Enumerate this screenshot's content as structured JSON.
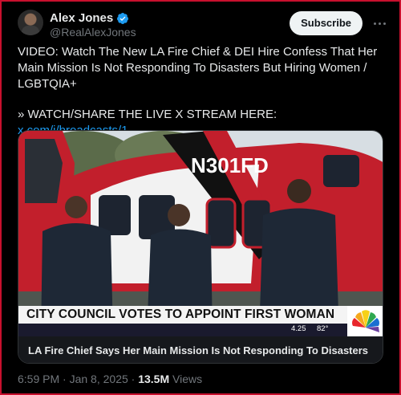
{
  "author": {
    "display_name": "Alex Jones",
    "handle": "@RealAlexJones",
    "verified_icon": "verified-badge-icon"
  },
  "actions": {
    "subscribe_label": "Subscribe",
    "more_icon": "more-horizontal-icon"
  },
  "tweet": {
    "line1": "VIDEO: Watch The New LA Fire Chief & DEI Hire Confess That Her Main Mission Is Not Responding To Disasters But Hiring Women / LGBTQIA+",
    "line2": "» WATCH/SHARE THE LIVE X STREAM HERE:",
    "link": "x.com/i/broadcasts/1..."
  },
  "media": {
    "tail_number": "N301FD",
    "chyron": "CITY COUNCIL VOTES TO APPOINT FIRST WOMAN TO LEAD LAFD",
    "ticker_time": "4.25",
    "ticker_temp": "82°",
    "caption": "LA Fire Chief Says Her Main Mission Is Not Responding To Disasters",
    "logo": "nbc-peacock-logo"
  },
  "meta": {
    "time": "6:59 PM",
    "sep1": " · ",
    "date": "Jan 8, 2025",
    "sep2": " · ",
    "views": "13.5M",
    "views_label": " Views"
  },
  "colors": {
    "background": "#000000",
    "link": "#1d9bf0",
    "frame": "#c8102e",
    "verified": "#1d9bf0",
    "helicopter_red": "#c21f2c"
  }
}
